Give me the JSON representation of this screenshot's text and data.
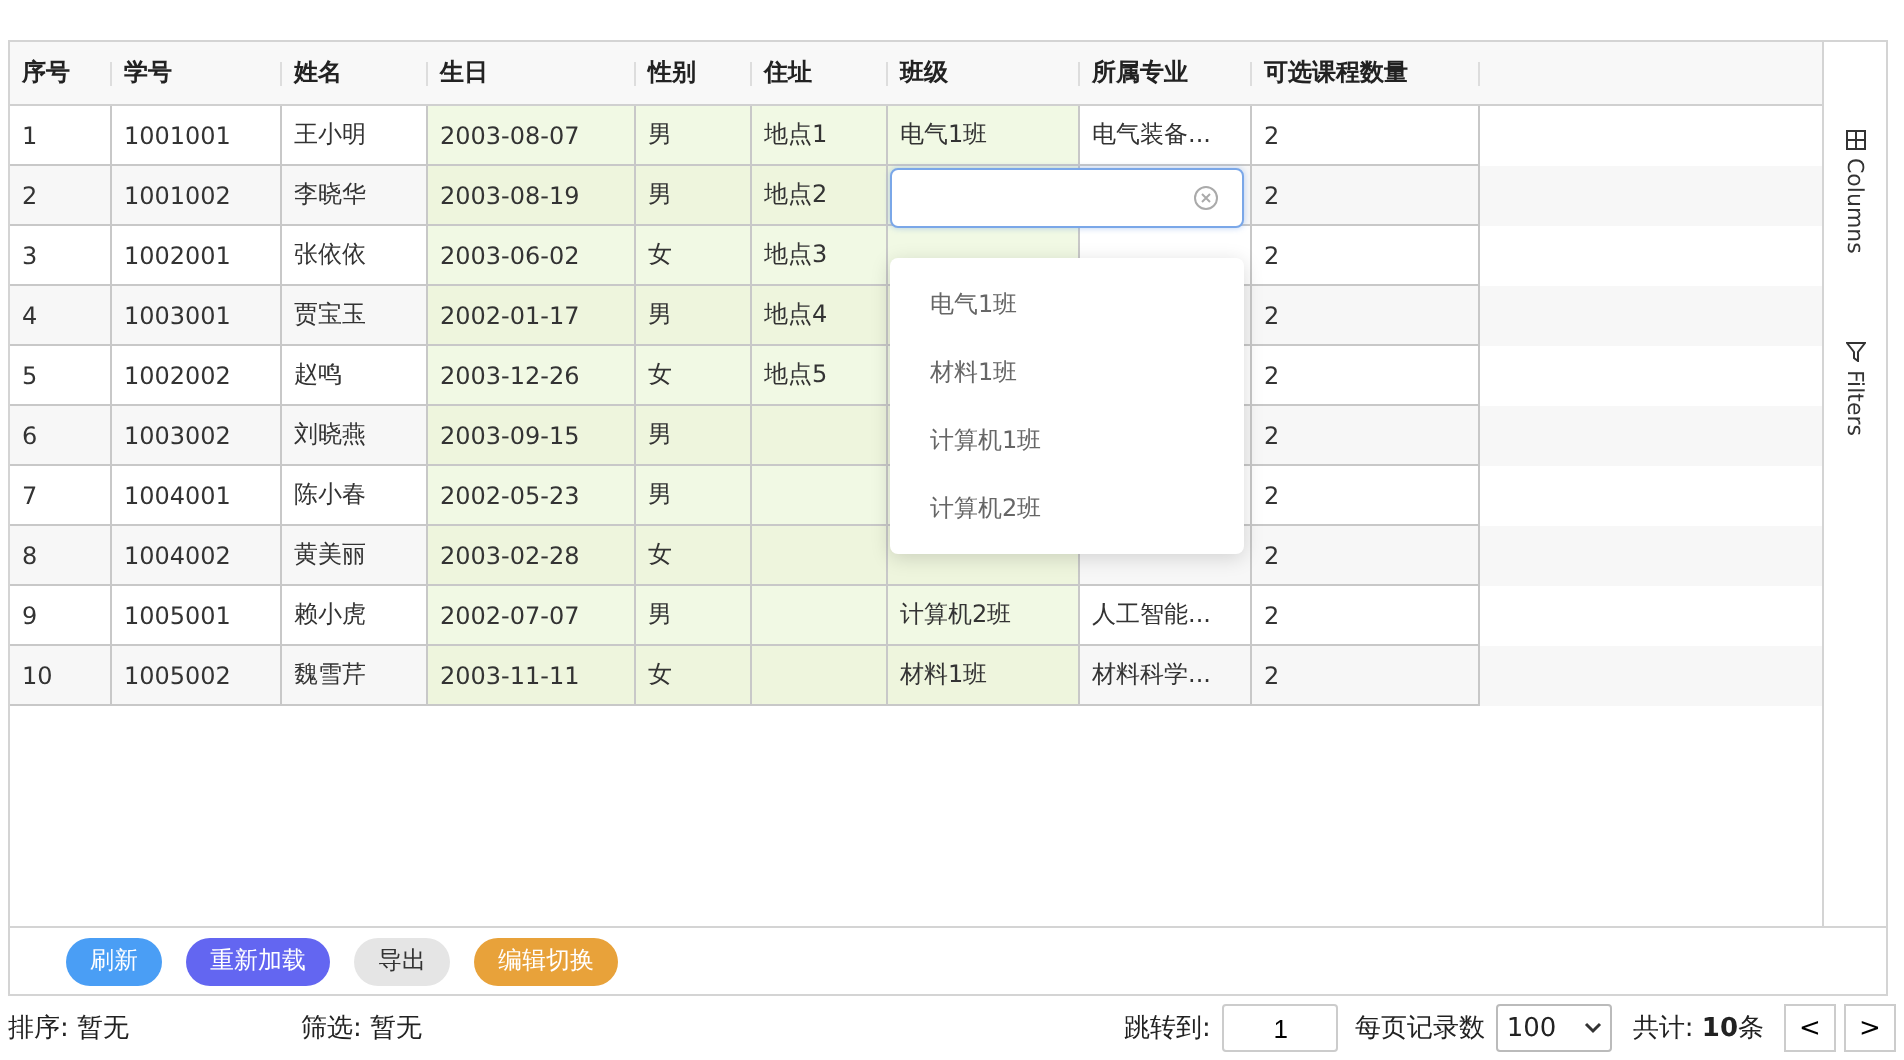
{
  "columns": [
    {
      "label": "序号",
      "editable": false
    },
    {
      "label": "学号",
      "editable": false
    },
    {
      "label": "姓名",
      "editable": false
    },
    {
      "label": "生日",
      "editable": true
    },
    {
      "label": "性别",
      "editable": true
    },
    {
      "label": "住址",
      "editable": true
    },
    {
      "label": "班级",
      "editable": true
    },
    {
      "label": "所属专业",
      "editable": false
    },
    {
      "label": "可选课程数量",
      "editable": false
    }
  ],
  "rows": [
    {
      "editing": false,
      "cells": [
        "1",
        "1001001",
        "王小明",
        "2003-08-07",
        "男",
        "地点1",
        "电气1班",
        "电气装备...",
        "2"
      ]
    },
    {
      "editing": true,
      "cells": [
        "2",
        "1001002",
        "李晓华",
        "2003-08-19",
        "男",
        "地点2",
        null,
        null,
        "2"
      ]
    },
    {
      "editing": false,
      "cells": [
        "3",
        "1002001",
        "张依依",
        "2003-06-02",
        "女",
        "地点3",
        null,
        null,
        "2"
      ]
    },
    {
      "editing": false,
      "cells": [
        "4",
        "1003001",
        "贾宝玉",
        "2002-01-17",
        "男",
        "地点4",
        null,
        null,
        "2"
      ]
    },
    {
      "editing": false,
      "cells": [
        "5",
        "1002002",
        "赵鸣",
        "2003-12-26",
        "女",
        "地点5",
        null,
        null,
        "2"
      ]
    },
    {
      "editing": false,
      "cells": [
        "6",
        "1003002",
        "刘晓燕",
        "2003-09-15",
        "男",
        null,
        null,
        null,
        "2"
      ]
    },
    {
      "editing": false,
      "cells": [
        "7",
        "1004001",
        "陈小春",
        "2002-05-23",
        "男",
        null,
        null,
        null,
        "2"
      ]
    },
    {
      "editing": false,
      "cells": [
        "8",
        "1004002",
        "黄美丽",
        "2003-02-28",
        "女",
        null,
        null,
        null,
        "2"
      ]
    },
    {
      "editing": false,
      "cells": [
        "9",
        "1005001",
        "赖小虎",
        "2002-07-07",
        "男",
        null,
        "计算机2班",
        "人工智能...",
        "2"
      ]
    },
    {
      "editing": false,
      "cells": [
        "10",
        "1005002",
        "魏雪芹",
        "2003-11-11",
        "女",
        null,
        "材料1班",
        "材料科学...",
        "2"
      ]
    }
  ],
  "dropdown": {
    "options": [
      "电气1班",
      "材料1班",
      "计算机1班",
      "计算机2班"
    ]
  },
  "side_tabs": [
    {
      "kind": "columns",
      "label": "Columns"
    },
    {
      "kind": "filters",
      "label": "Filters"
    }
  ],
  "buttons": [
    {
      "label": "刷新",
      "color": "#4a9ef5"
    },
    {
      "label": "重新加载",
      "color": "#6366f1"
    },
    {
      "label": "导出",
      "color": "#e5e5e5"
    },
    {
      "label": "编辑切换",
      "color": "#e8a23a"
    }
  ],
  "status": {
    "sort": "排序: 暂无",
    "filter": "筛选: 暂无"
  },
  "pagination": {
    "jump_label": "跳转到:",
    "page": "1",
    "page_size_label": "每页记录数",
    "page_size": "100",
    "total": "共计: **10**条",
    "prev": "<",
    "next": ">"
  }
}
